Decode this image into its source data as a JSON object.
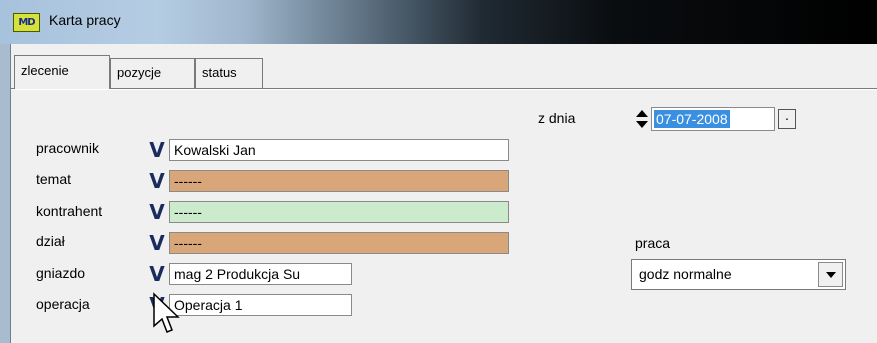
{
  "window": {
    "title": "Karta pracy",
    "app_icon_text": "MD"
  },
  "tabs": [
    {
      "label": "zlecenie",
      "active": true
    },
    {
      "label": "pozycje",
      "active": false
    },
    {
      "label": "status",
      "active": false
    }
  ],
  "date": {
    "label": "z dnia",
    "value": "07-07-2008"
  },
  "fields": {
    "pracownik": {
      "label": "pracownik",
      "value": "Kowalski Jan"
    },
    "temat": {
      "label": "temat",
      "value": "------"
    },
    "kontrahent": {
      "label": "kontrahent",
      "value": "------"
    },
    "dzial": {
      "label": "dział",
      "value": "------"
    },
    "gniazdo": {
      "label": "gniazdo",
      "value": "mag 2  Produkcja Su"
    },
    "operacja": {
      "label": "operacja",
      "value": "Operacja 1"
    }
  },
  "praca": {
    "label": "praca",
    "selected": "godz normalne"
  },
  "check_glyph": "V",
  "colors": {
    "tan": "#d9a679",
    "green": "#cceacc",
    "selection": "#3a8fe0",
    "check": "#1a2c5e"
  }
}
